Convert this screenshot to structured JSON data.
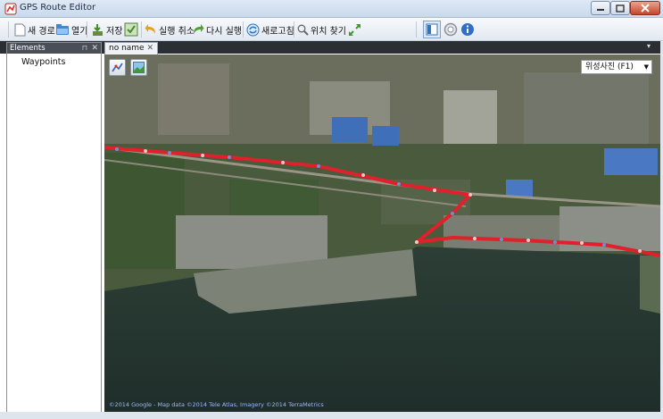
{
  "window": {
    "title": "GPS Route Editor"
  },
  "toolbar": {
    "new_route": "새 경로",
    "open": "열기",
    "save": "저장",
    "undo": "실행 취소",
    "redo": "다시 실행",
    "refresh": "새로고침",
    "find_location": "위치 찾기"
  },
  "panel": {
    "title": "Elements",
    "items": [
      "Waypoints"
    ]
  },
  "document": {
    "tab_title": "no name"
  },
  "map": {
    "type_selected": "위성사진 (F1)",
    "attribution": "©2014 Google - Map data ©2014 Tele Atlas, Imagery ©2014 TerraMetrics",
    "route_color": "#e0202a"
  }
}
